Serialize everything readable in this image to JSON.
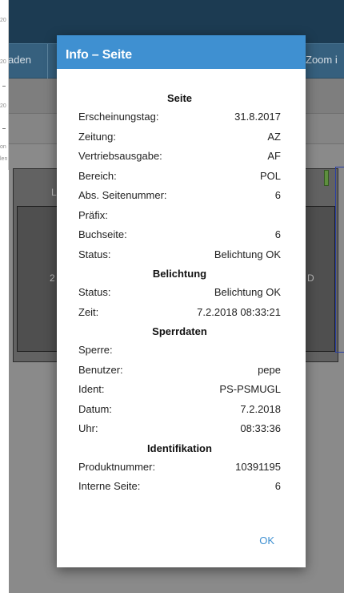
{
  "background": {
    "left_strip_fragments": [
      "20",
      "20",
      "20",
      "on",
      "len"
    ],
    "menu": {
      "item_loaden": "aden",
      "item_zoom": "Zoom i"
    },
    "page_fragments": {
      "left_l": "L",
      "left_num": "2",
      "right_d": "D"
    }
  },
  "dialog": {
    "title": "Info – Seite",
    "sections": [
      {
        "heading": "Seite",
        "rows": [
          {
            "label": "Erscheinungstag:",
            "value": "31.8.2017"
          },
          {
            "label": "Zeitung:",
            "value": "AZ"
          },
          {
            "label": "Vertriebsausgabe:",
            "value": "AF"
          },
          {
            "label": "Bereich:",
            "value": "POL"
          },
          {
            "label": "Abs. Seitenummer:",
            "value": "6"
          },
          {
            "label": "Präfix:",
            "value": ""
          },
          {
            "label": "Buchseite:",
            "value": "6"
          },
          {
            "label": "Status:",
            "value": "Belichtung OK"
          }
        ]
      },
      {
        "heading": "Belichtung",
        "rows": [
          {
            "label": "Status:",
            "value": "Belichtung OK"
          },
          {
            "label": "Zeit:",
            "value": "7.2.2018 08:33:21"
          }
        ]
      },
      {
        "heading": "Sperrdaten",
        "rows": [
          {
            "label": "Sperre:",
            "value": ""
          },
          {
            "label": "Benutzer:",
            "value": "pepe"
          },
          {
            "label": "Ident:",
            "value": "PS-PSMUGL"
          },
          {
            "label": "Datum:",
            "value": "7.2.2018"
          },
          {
            "label": "Uhr:",
            "value": "08:33:36"
          }
        ]
      },
      {
        "heading": "Identifikation",
        "rows": [
          {
            "label": "Produktnummer:",
            "value": "10391195"
          },
          {
            "label": "Interne Seite:",
            "value": "6"
          }
        ]
      }
    ],
    "ok_label": "OK"
  },
  "colors": {
    "dialog_title_bg": "#3f90d1",
    "ok_text": "#3f90d1",
    "app_header": "#1c3b52",
    "app_menubar": "#36607e"
  }
}
